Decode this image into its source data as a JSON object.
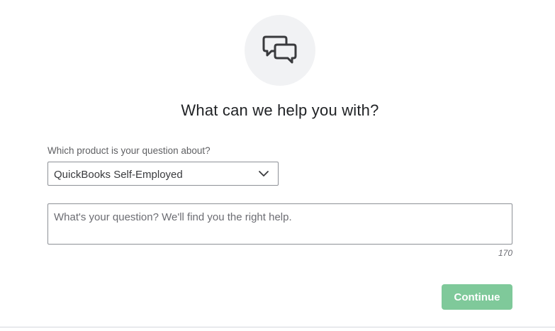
{
  "dialog": {
    "icon": "chat-bubbles-icon",
    "heading": "What can we help you with?"
  },
  "product_field": {
    "label": "Which product is your question about?",
    "selected_value": "QuickBooks Self-Employed",
    "chevron_icon": "chevron-down-icon"
  },
  "question_field": {
    "placeholder": "What's your question? We'll find you the right help.",
    "value": "",
    "remaining_chars": "170"
  },
  "actions": {
    "continue_label": "Continue"
  },
  "colors": {
    "continue_button": "#7fc99a",
    "icon_circle": "#f1f2f4",
    "heading_text": "#1f2124"
  }
}
